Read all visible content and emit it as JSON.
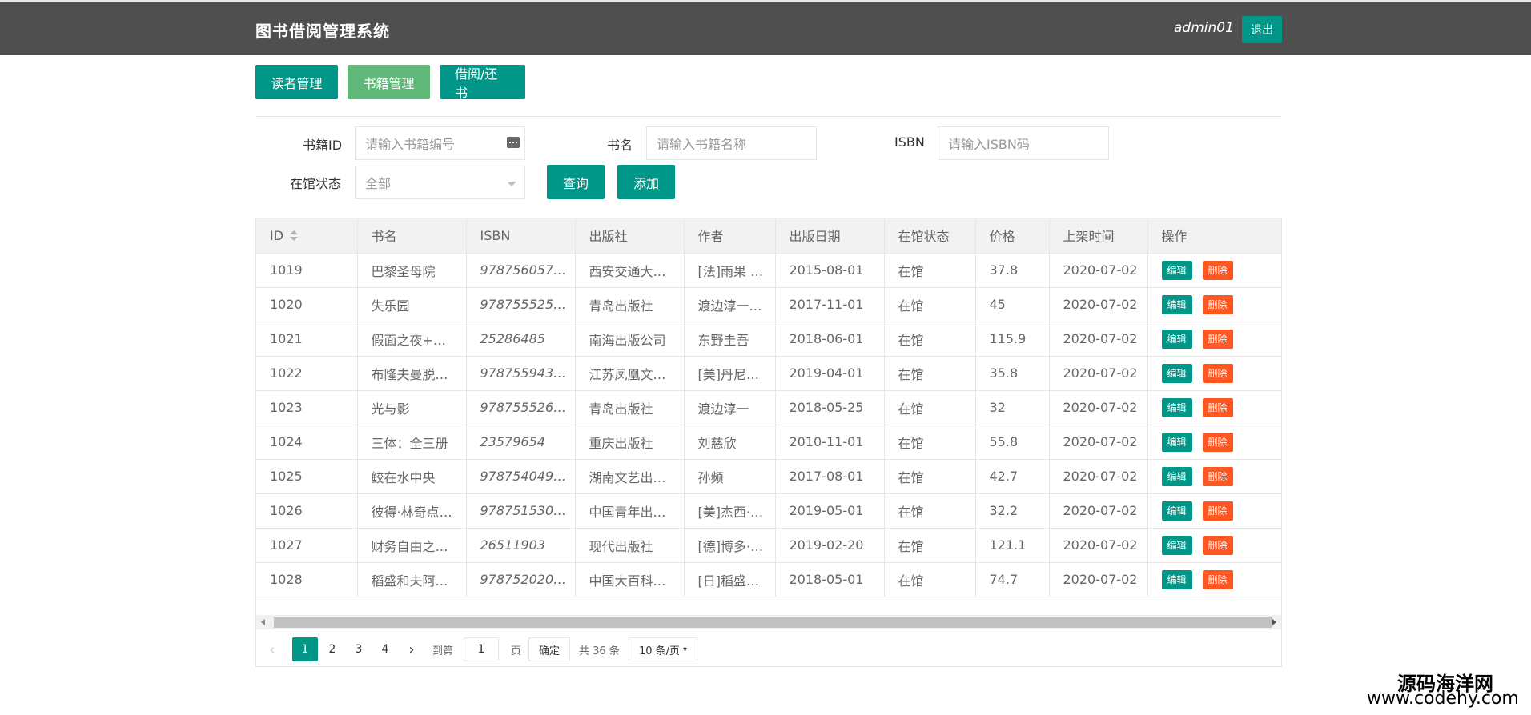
{
  "header": {
    "title": "图书借阅管理系统",
    "user": "admin01",
    "logout_label": "退出"
  },
  "nav": {
    "readers": "读者管理",
    "books": "书籍管理",
    "borrow": "借阅/还书"
  },
  "search": {
    "book_id_label": "书籍ID",
    "book_id_placeholder": "请输入书籍编号",
    "title_label": "书名",
    "title_placeholder": "请输入书籍名称",
    "isbn_label": "ISBN",
    "isbn_placeholder": "请输入ISBN码",
    "status_label": "在馆状态",
    "status_value": "全部",
    "query_label": "查询",
    "add_label": "添加"
  },
  "table": {
    "headers": [
      "ID",
      "书名",
      "ISBN",
      "出版社",
      "作者",
      "出版日期",
      "在馆状态",
      "价格",
      "上架时间",
      "操作"
    ],
    "edit_label": "编辑",
    "delete_label": "删除",
    "rows": [
      [
        "1019",
        "巴黎圣母院",
        "978756057…",
        "西安交通大…",
        "[法]雨果 …",
        "2015-08-01",
        "在馆",
        "37.8",
        "2020-07-02"
      ],
      [
        "1020",
        "失乐园",
        "978755525…",
        "青岛出版社",
        "渡边淳一…",
        "2017-11-01",
        "在馆",
        "45",
        "2020-07-02"
      ],
      [
        "1021",
        "假面之夜+…",
        "25286485",
        "南海出版公司",
        "东野圭吾",
        "2018-06-01",
        "在馆",
        "115.9",
        "2020-07-02"
      ],
      [
        "1022",
        "布隆夫曼脱…",
        "978755943…",
        "江苏凤凰文…",
        "[美]丹尼…",
        "2019-04-01",
        "在馆",
        "35.8",
        "2020-07-02"
      ],
      [
        "1023",
        "光与影",
        "978755526…",
        "青岛出版社",
        "渡边淳一",
        "2018-05-25",
        "在馆",
        "32",
        "2020-07-02"
      ],
      [
        "1024",
        "三体：全三册",
        "23579654",
        "重庆出版社",
        "刘慈欣",
        "2010-11-01",
        "在馆",
        "55.8",
        "2020-07-02"
      ],
      [
        "1025",
        "鲛在水中央",
        "978754049…",
        "湖南文艺出…",
        "孙频",
        "2017-08-01",
        "在馆",
        "42.7",
        "2020-07-02"
      ],
      [
        "1026",
        "彼得·林奇点…",
        "978751530…",
        "中国青年出…",
        "[美]杰西·…",
        "2019-05-01",
        "在馆",
        "32.2",
        "2020-07-02"
      ],
      [
        "1027",
        "财务自由之…",
        "26511903",
        "现代出版社",
        "[德]博多·…",
        "2019-02-20",
        "在馆",
        "121.1",
        "2020-07-02"
      ],
      [
        "1028",
        "稻盛和夫阿…",
        "978752020…",
        "中国大百科…",
        "[日]稻盛…",
        "2018-05-01",
        "在馆",
        "74.7",
        "2020-07-02"
      ]
    ]
  },
  "pager": {
    "pages": [
      "1",
      "2",
      "3",
      "4"
    ],
    "goto_label": "到第",
    "goto_value": "1",
    "page_unit": "页",
    "confirm_label": "确定",
    "total_label": "共 36 条",
    "page_size": "10 条/页"
  },
  "watermark": {
    "name": "源码海洋网",
    "url": "www.codehy.com"
  }
}
